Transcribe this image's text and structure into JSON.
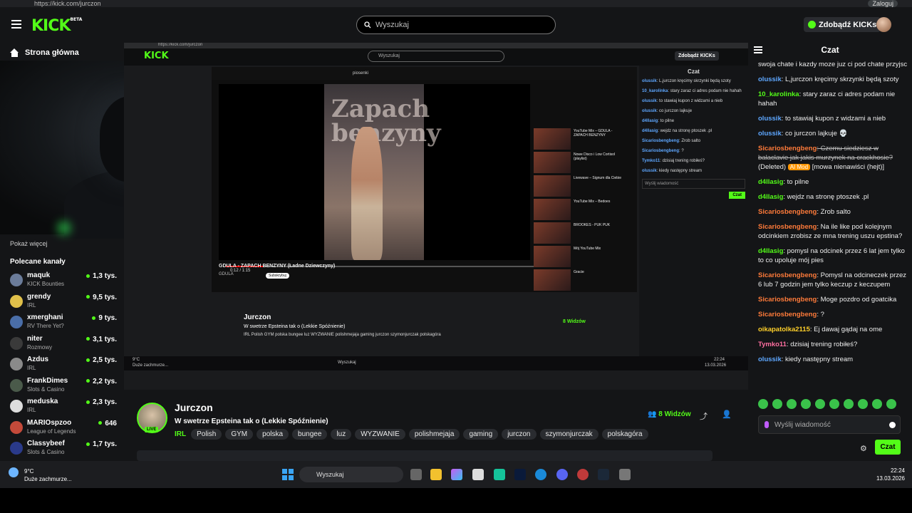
{
  "browser": {
    "url": "https://kick.com/jurczon",
    "login_label": "Zaloguj"
  },
  "header": {
    "logo": "KICK",
    "logo_sup": "BETA",
    "search_placeholder": "Wyszukaj",
    "kicks_label": "Zdobądź KICKs"
  },
  "sidebar": {
    "home_label": "Strona główna",
    "show_more": "Pokaż więcej",
    "recommended_title": "Polecane kanały",
    "channels": [
      {
        "name": "maquk",
        "category": "KICK Bounties",
        "viewers": "1,3 tys.",
        "color": "#6b7c9a"
      },
      {
        "name": "grendy",
        "category": "IRL",
        "viewers": "9,5 tys.",
        "color": "#e0c04a"
      },
      {
        "name": "xmerghani",
        "category": "RV There Yet?",
        "viewers": "9 tys.",
        "color": "#4a6ea8"
      },
      {
        "name": "niter",
        "category": "Rozmowy",
        "viewers": "3,1 tys.",
        "color": "#3a3a3a"
      },
      {
        "name": "Azdus",
        "category": "IRL",
        "viewers": "2,5 tys.",
        "color": "#8a8a8a"
      },
      {
        "name": "FrankDimes",
        "category": "Slots & Casino",
        "viewers": "2,2 tys.",
        "color": "#4a5a4a"
      },
      {
        "name": "meduska",
        "category": "IRL",
        "viewers": "2,3 tys.",
        "color": "#dddddd"
      },
      {
        "name": "MARIOspzoo",
        "category": "League of Legends",
        "viewers": "646",
        "color": "#c44a3a"
      },
      {
        "name": "Classybeef",
        "category": "Slots & Casino",
        "viewers": "1,7 tys.",
        "color": "#2a3a8a"
      }
    ]
  },
  "video": {
    "inner_url": "https://kick.com/jurczon",
    "inner_search": "Wyszukaj",
    "inner_kicks": "Zdobądź KICKs",
    "yt_query": "piosenki",
    "yt_overlay_text": "Zapach benzyny",
    "yt_time": "0:12 / 1:15",
    "yt_title": "GDULA - ZAPACH BENZYNY (Ładne Dziewczyny)",
    "yt_channel": "GDULA",
    "yt_subscribe": "Subskrybuj",
    "yt_recs": [
      "YouTube Mix – GDULA - ZAPACH BENZYNY",
      "Nowe Disco i Low Cortisol (playlist)",
      "Livewave – Signum dla Ciebie",
      "YouTube Mix – Bedoes",
      "BROOKES - PUK PUK",
      "Mój YouTube Mix",
      "Gracie"
    ],
    "inner_chat_title": "Czat",
    "inner_chat_placeholder": "Wyślij wiadomość",
    "inner_chat_send": "Czat",
    "inner_chat": [
      {
        "u": "olussik",
        "t": ": L,jurczon kręcimy skrzynki będą szoty"
      },
      {
        "u": "10_karolinka",
        "t": ": stary zaraz ci adres podam nie hahah"
      },
      {
        "u": "olussik",
        "t": ": to stawiaj kupon z widzami a nieb"
      },
      {
        "u": "olussik",
        "t": ": co jurczon lajkuje"
      },
      {
        "u": "d4llasig",
        "t": ": to pilne"
      },
      {
        "u": "d4llasig",
        "t": ": wejdz na stronę ptoszek .pl"
      },
      {
        "u": "Sicariosbengbeng",
        "t": ": Zrob salto"
      },
      {
        "u": "Sicariosbengbeng",
        "t": ": ?"
      },
      {
        "u": "Tymko11",
        "t": ": dzisiaj trening robiłeś?"
      },
      {
        "u": "olussik",
        "t": ": kiedy następny stream"
      }
    ],
    "inner_taskbar_search": "Wyszukaj",
    "inner_weather_temp": "9°C",
    "inner_weather_desc": "Duże zachmurze...",
    "inner_clock": "22:24",
    "inner_date": "13.03.2026",
    "inner_stream_name": "Jurczon",
    "inner_stream_title": "W swetrze Epsteina tak o (Lekkie Spóźnienie)",
    "inner_tags": "IRL  Polish  GYM  polska  bungee  luz  WYZWANIE  polishmejaja  gaming  jurczon  szymonjurczak  polskagóra",
    "inner_viewers": "8 Widzów"
  },
  "stream": {
    "name": "Jurczon",
    "live": "LIVE",
    "title": "W swetrze Epsteina tak o (Lekkie Spóźnienie)",
    "category": "IRL",
    "tags": [
      "Polish",
      "GYM",
      "polska",
      "bungee",
      "luz",
      "WYZWANIE",
      "polishmejaja",
      "gaming",
      "jurczon",
      "szymonjurczak",
      "polskagóra"
    ],
    "viewers": "8 Widzów"
  },
  "chat": {
    "title": "Czat",
    "intro": "swoja chate i kazdy moze juz ci pod chate przyjsc",
    "messages": [
      {
        "u": "olussik",
        "c": "blue",
        "t": ": L,jurczon kręcimy skrzynki będą szoty"
      },
      {
        "u": "10_karolinka",
        "c": "green",
        "t": ": stary zaraz ci adres podam nie hahah"
      },
      {
        "u": "olussik",
        "c": "blue",
        "t": ": to stawiaj kupon z widzami a nieb"
      },
      {
        "u": "olussik",
        "c": "blue",
        "t": ": co jurczon lajkuje 💀"
      },
      {
        "u": "Sicariosbengbeng",
        "c": "orange",
        "t": ": Czemu siedziesz w balaclavie jak jakis murzynek na crackhosie?",
        "deleted": " (Deleted) ",
        "badge": "AI Mod",
        "note": " [mowa nienawiści (hejt)]"
      },
      {
        "u": "d4llasig",
        "c": "green",
        "t": ": to pilne"
      },
      {
        "u": "d4llasig",
        "c": "green",
        "t": ": wejdz na stronę ptoszek .pl"
      },
      {
        "u": "Sicariosbengbeng",
        "c": "orange",
        "t": ": Zrob salto"
      },
      {
        "u": "Sicariosbengbeng",
        "c": "orange",
        "t": ": Na ile like pod kolejnym odcinkiem zrobisz ze mna trening uszu epstina?"
      },
      {
        "u": "d4llasig",
        "c": "green",
        "t": ": pomysl na odcinek przez 6 lat jem tylko to co upoluje mój pies"
      },
      {
        "u": "Sicariosbengbeng",
        "c": "orange",
        "t": ": Pomysl na odcineczek przez 6 lub 7 godzin jem tylko keczup z keczupem"
      },
      {
        "u": "Sicariosbengbeng",
        "c": "orange",
        "t": ": Moge pozdro od goatcika"
      },
      {
        "u": "Sicariosbengbeng",
        "c": "orange",
        "t": ": ?"
      },
      {
        "u": "oikapatolka2115",
        "c": "ylw",
        "t": ": Ej dawaj gądaj na ome"
      },
      {
        "u": "Tymko11",
        "c": "pink",
        "t": ": dzisiaj trening robiłeś?"
      },
      {
        "u": "olussik",
        "c": "blue",
        "t": ": kiedy następny stream"
      }
    ],
    "placeholder": "Wyślij wiadomość",
    "send_label": "Czat"
  },
  "taskbar": {
    "weather_temp": "9°C",
    "weather_desc": "Duże zachmurze...",
    "search_label": "Wyszukaj",
    "time": "22:24",
    "date": "13.03.2026"
  }
}
